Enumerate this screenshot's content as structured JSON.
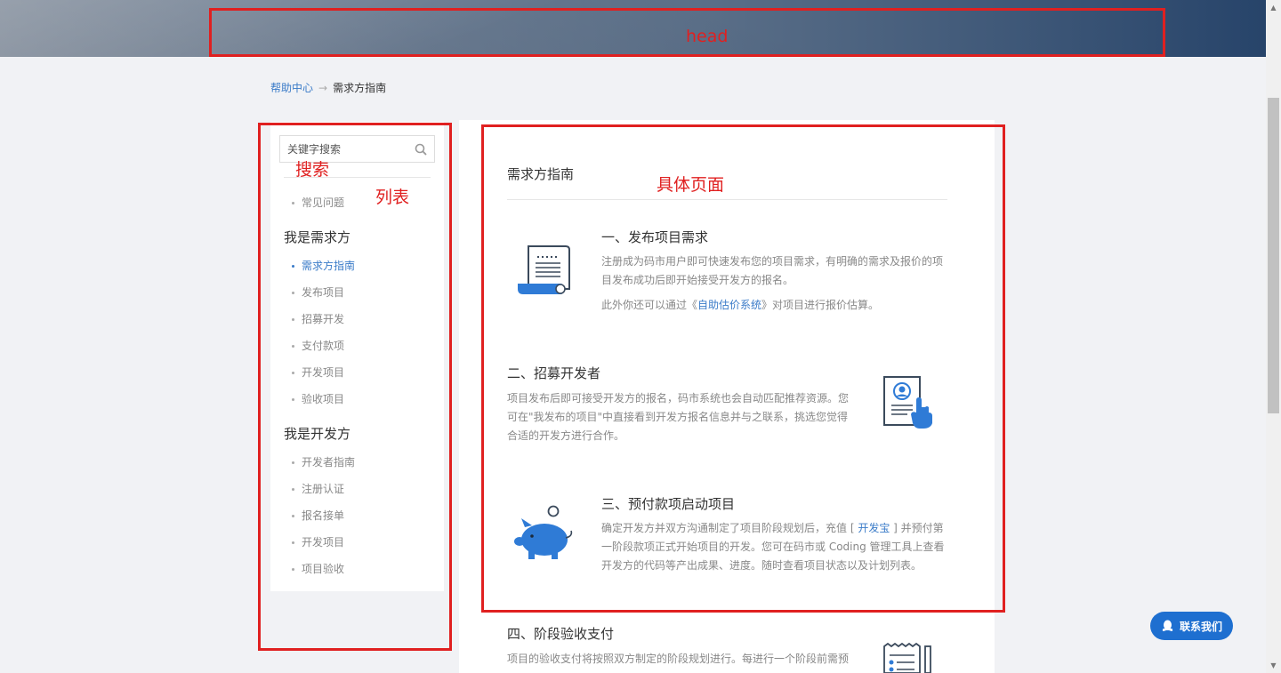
{
  "annotations": {
    "head": "head",
    "search": "搜索",
    "list": "列表",
    "page": "具体页面"
  },
  "breadcrumb": {
    "home": "帮助中心",
    "arrow": "→",
    "current": "需求方指南"
  },
  "sidebar": {
    "search_placeholder": "关键字搜索",
    "faq": "常见问题",
    "group1": "我是需求方",
    "group1_items": [
      "需求方指南",
      "发布项目",
      "招募开发",
      "支付款项",
      "开发项目",
      "验收项目"
    ],
    "group2": "我是开发方",
    "group2_items": [
      "开发者指南",
      "注册认证",
      "报名接单",
      "开发项目",
      "项目验收"
    ]
  },
  "content": {
    "title": "需求方指南",
    "s1": {
      "title": "一、发布项目需求",
      "text1": "注册成为码市用户即可快速发布您的项目需求，有明确的需求及报价的项目发布成功后即开始接受开发方的报名。",
      "text2_pre": "此外你还可以通过《",
      "text2_link": "自助估价系统",
      "text2_post": "》对项目进行报价估算。"
    },
    "s2": {
      "title": "二、招募开发者",
      "text": "项目发布后即可接受开发方的报名，码市系统也会自动匹配推荐资源。您可在\"我发布的项目\"中直接看到开发方报名信息并与之联系，挑选您觉得合适的开发方进行合作。"
    },
    "s3": {
      "title": "三、预付款项启动项目",
      "text_pre": "确定开发方并双方沟通制定了项目阶段规划后，充值 [ ",
      "text_link": "开发宝",
      "text_post": " ] 并预付第一阶段款项正式开始项目的开发。您可在码市或 Coding 管理工具上查看开发方的代码等产出成果、进度。随时查看项目状态以及计划列表。"
    },
    "s4": {
      "title": "四、阶段验收支付",
      "text": "项目的验收支付将按照双方制定的阶段规划进行。每进行一个阶段前需预"
    }
  },
  "contact": {
    "label": "联系我们"
  },
  "colors": {
    "accent": "#3a7bc8",
    "annotation": "#e02020",
    "contact_bg": "#1e6fd0"
  }
}
